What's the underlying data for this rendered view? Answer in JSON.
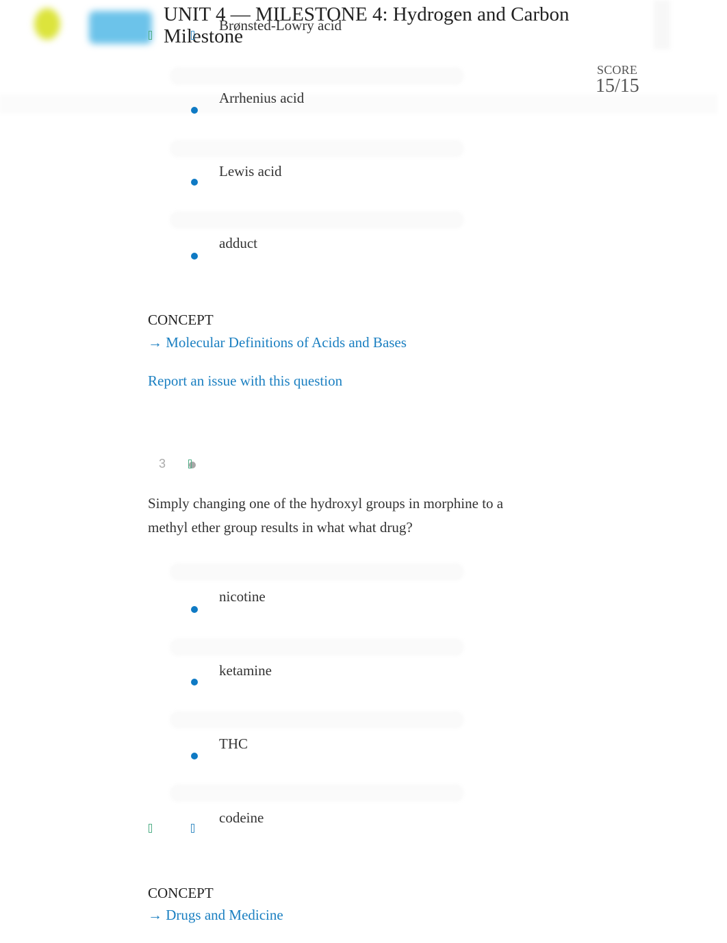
{
  "header": {
    "title": "UNIT 4 — MILESTONE 4: Hydrogen and Carbon Milestone",
    "score_label": "SCORE",
    "score_value": "15/15"
  },
  "question_2_tail": {
    "options": [
      {
        "label": "Brønsted-Lowry acid",
        "selected": false
      },
      {
        "label": "Arrhenius acid",
        "selected": false
      },
      {
        "label": "Lewis acid",
        "selected": false
      },
      {
        "label": "adduct",
        "selected": false
      }
    ],
    "concept_label": "CONCEPT",
    "concept_link": "→ Molecular Definitions of Acids and Bases",
    "report_link": "Report an issue with this question"
  },
  "question_3": {
    "number": "3",
    "text": "Simply changing one of the hydroxyl groups in morphine to a methyl ether group results in what what drug?",
    "options": [
      {
        "label": "nicotine",
        "selected": false
      },
      {
        "label": "ketamine",
        "selected": false
      },
      {
        "label": "THC",
        "selected": false
      },
      {
        "label": "codeine",
        "selected": true
      }
    ],
    "concept_label": "CONCEPT",
    "concept_link": "→ Drugs and Medicine"
  },
  "colors": {
    "accent_link": "#1a7fc1",
    "bullet": "#0f7ac4",
    "correct_marker": "#4fae86"
  }
}
